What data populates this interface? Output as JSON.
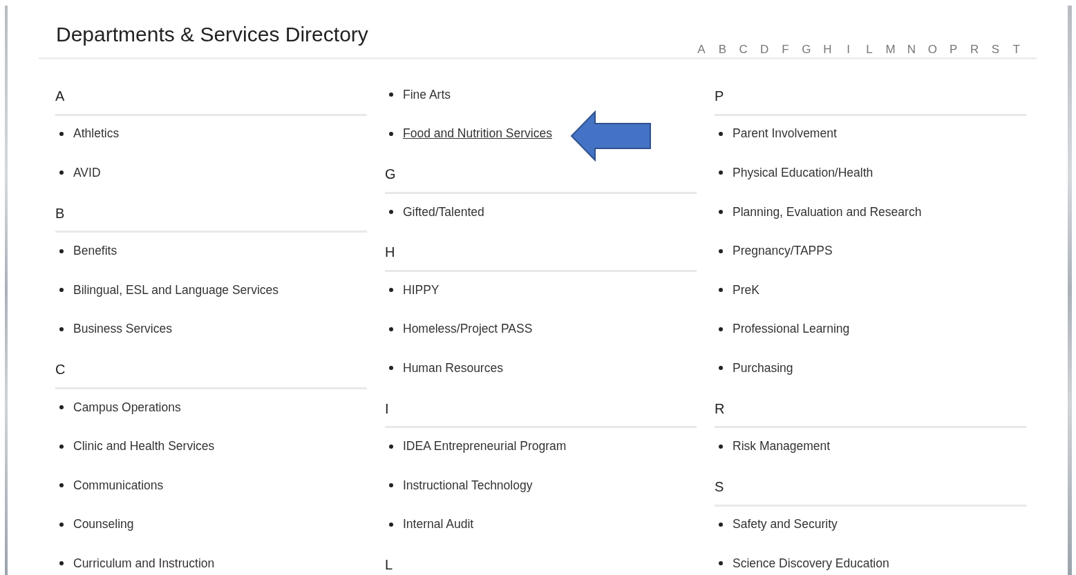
{
  "title": "Departments & Services Directory",
  "letter_nav": [
    "A",
    "B",
    "C",
    "D",
    "F",
    "G",
    "H",
    "I",
    "L",
    "M",
    "N",
    "O",
    "P",
    "R",
    "S",
    "T"
  ],
  "columns": [
    {
      "entries": [
        {
          "kind": "heading",
          "text": "A"
        },
        {
          "kind": "link",
          "text": "Athletics",
          "underlined": false
        },
        {
          "kind": "link",
          "text": "AVID",
          "underlined": false
        },
        {
          "kind": "heading",
          "text": "B"
        },
        {
          "kind": "link",
          "text": "Benefits",
          "underlined": false
        },
        {
          "kind": "link",
          "text": "Bilingual, ESL and Language Services",
          "underlined": false
        },
        {
          "kind": "link",
          "text": "Business Services",
          "underlined": false
        },
        {
          "kind": "heading",
          "text": "C"
        },
        {
          "kind": "link",
          "text": "Campus Operations",
          "underlined": false
        },
        {
          "kind": "link",
          "text": "Clinic and Health Services",
          "underlined": false
        },
        {
          "kind": "link",
          "text": "Communications",
          "underlined": false
        },
        {
          "kind": "link",
          "text": "Counseling",
          "underlined": false
        },
        {
          "kind": "link",
          "text": "Curriculum and Instruction",
          "underlined": false
        }
      ]
    },
    {
      "entries": [
        {
          "kind": "link",
          "text": "Fine Arts",
          "underlined": false
        },
        {
          "kind": "link",
          "text": "Food and Nutrition Services",
          "underlined": true
        },
        {
          "kind": "heading",
          "text": "G"
        },
        {
          "kind": "link",
          "text": "Gifted/Talented",
          "underlined": false
        },
        {
          "kind": "heading",
          "text": "H"
        },
        {
          "kind": "link",
          "text": "HIPPY",
          "underlined": false
        },
        {
          "kind": "link",
          "text": "Homeless/Project PASS",
          "underlined": false
        },
        {
          "kind": "link",
          "text": "Human Resources",
          "underlined": false
        },
        {
          "kind": "heading",
          "text": "I"
        },
        {
          "kind": "link",
          "text": "IDEA Entrepreneurial Program",
          "underlined": false
        },
        {
          "kind": "link",
          "text": "Instructional Technology",
          "underlined": false
        },
        {
          "kind": "link",
          "text": "Internal Audit",
          "underlined": false
        },
        {
          "kind": "heading",
          "text": "L"
        }
      ]
    },
    {
      "entries": [
        {
          "kind": "heading",
          "text": "P"
        },
        {
          "kind": "link",
          "text": "Parent Involvement",
          "underlined": false
        },
        {
          "kind": "link",
          "text": "Physical Education/Health",
          "underlined": false
        },
        {
          "kind": "link",
          "text": "Planning, Evaluation and Research",
          "underlined": false
        },
        {
          "kind": "link",
          "text": "Pregnancy/TAPPS",
          "underlined": false
        },
        {
          "kind": "link",
          "text": "PreK",
          "underlined": false
        },
        {
          "kind": "link",
          "text": "Professional Learning",
          "underlined": false
        },
        {
          "kind": "link",
          "text": "Purchasing",
          "underlined": false
        },
        {
          "kind": "heading",
          "text": "R"
        },
        {
          "kind": "link",
          "text": "Risk Management",
          "underlined": false
        },
        {
          "kind": "heading",
          "text": "S"
        },
        {
          "kind": "link",
          "text": "Safety and Security",
          "underlined": false
        },
        {
          "kind": "link",
          "text": "Science Discovery Education",
          "underlined": false
        }
      ]
    }
  ]
}
